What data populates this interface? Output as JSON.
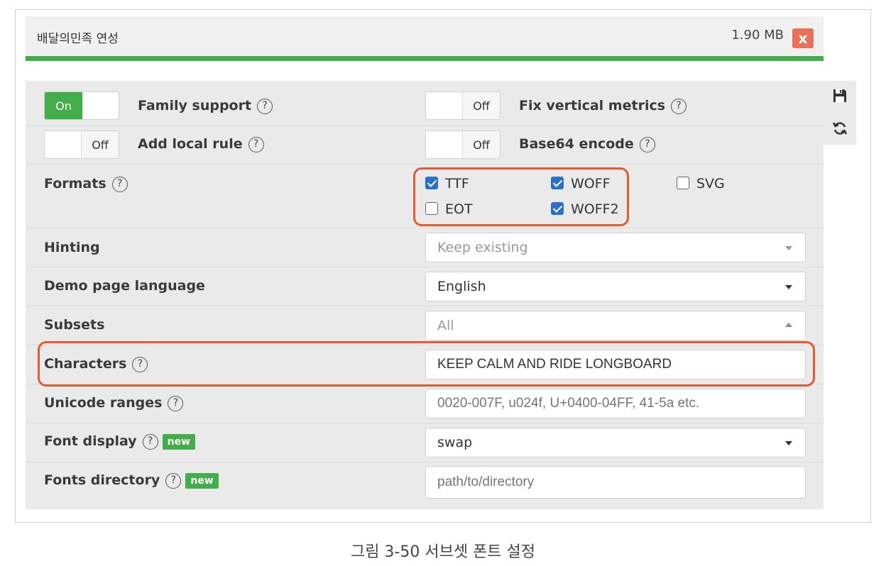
{
  "header": {
    "font_name": "배달의민족 연성",
    "file_size": "1.90 MB",
    "close_icon": "x"
  },
  "toggles": {
    "family_support": {
      "label": "Family support",
      "state": "On"
    },
    "fix_vertical": {
      "label": "Fix vertical metrics",
      "state": "Off"
    },
    "add_local": {
      "label": "Add local rule",
      "state": "Off"
    },
    "base64": {
      "label": "Base64 encode",
      "state": "Off"
    }
  },
  "help_symbol": "?",
  "formats": {
    "label": "Formats",
    "ttf": {
      "label": "TTF",
      "checked": true
    },
    "woff": {
      "label": "WOFF",
      "checked": true
    },
    "svg": {
      "label": "SVG",
      "checked": false
    },
    "eot": {
      "label": "EOT",
      "checked": false
    },
    "woff2": {
      "label": "WOFF2",
      "checked": true
    }
  },
  "hinting": {
    "label": "Hinting",
    "value": "Keep existing"
  },
  "demo_lang": {
    "label": "Demo page language",
    "value": "English"
  },
  "subsets": {
    "label": "Subsets",
    "value": "All"
  },
  "characters": {
    "label": "Characters",
    "value": "KEEP CALM AND RIDE LONGBOARD"
  },
  "unicode": {
    "label": "Unicode ranges",
    "placeholder": "0020-007F, u024f, U+0400-04FF, 41-5a etc."
  },
  "font_display": {
    "label": "Font display",
    "badge": "new",
    "value": "swap"
  },
  "fonts_dir": {
    "label": "Fonts directory",
    "badge": "new",
    "placeholder": "path/to/directory"
  },
  "caption": "그림 3-50 서브셋 폰트 설정",
  "colors": {
    "accent_green": "#43ad4b",
    "highlight": "#e35a35",
    "close_red": "#e8715b",
    "check_blue": "#2a6fc9"
  }
}
